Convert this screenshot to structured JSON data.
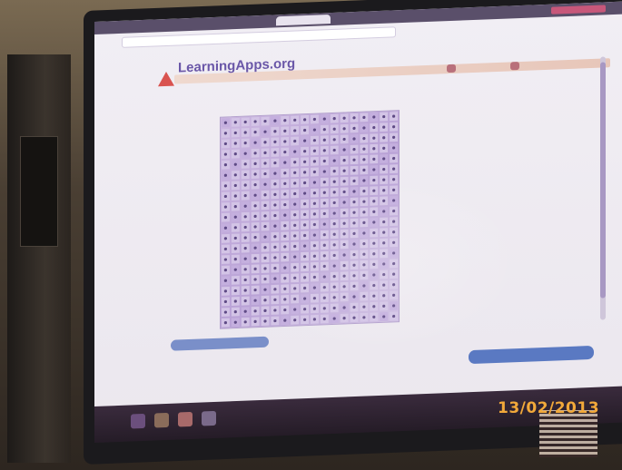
{
  "browser": {
    "tab_title": "",
    "top_links": ""
  },
  "site": {
    "title": "LearningApps.org",
    "nav_items": [
      "",
      ""
    ],
    "user_buttons": [
      "",
      ""
    ]
  },
  "breadcrumb": "",
  "puzzle": {
    "rows": 20,
    "cols": 18,
    "grid_color": "#b9a2d6"
  },
  "word_list": [
    "",
    "",
    "",
    "",
    "",
    "",
    "",
    ""
  ],
  "actions": {
    "print_label": "",
    "save_label": "",
    "link_left": "",
    "link_right": ""
  },
  "info_rows": [
    {
      "label": "",
      "value": ""
    },
    {
      "label": "",
      "value": ""
    },
    {
      "label": "",
      "value": ""
    },
    {
      "label": "",
      "value": ""
    }
  ],
  "photo_stamp": "13/02/2013",
  "colors": {
    "accent": "#6a57a8",
    "stamp": "#f2a93a",
    "save_button": "#5a79c2"
  }
}
